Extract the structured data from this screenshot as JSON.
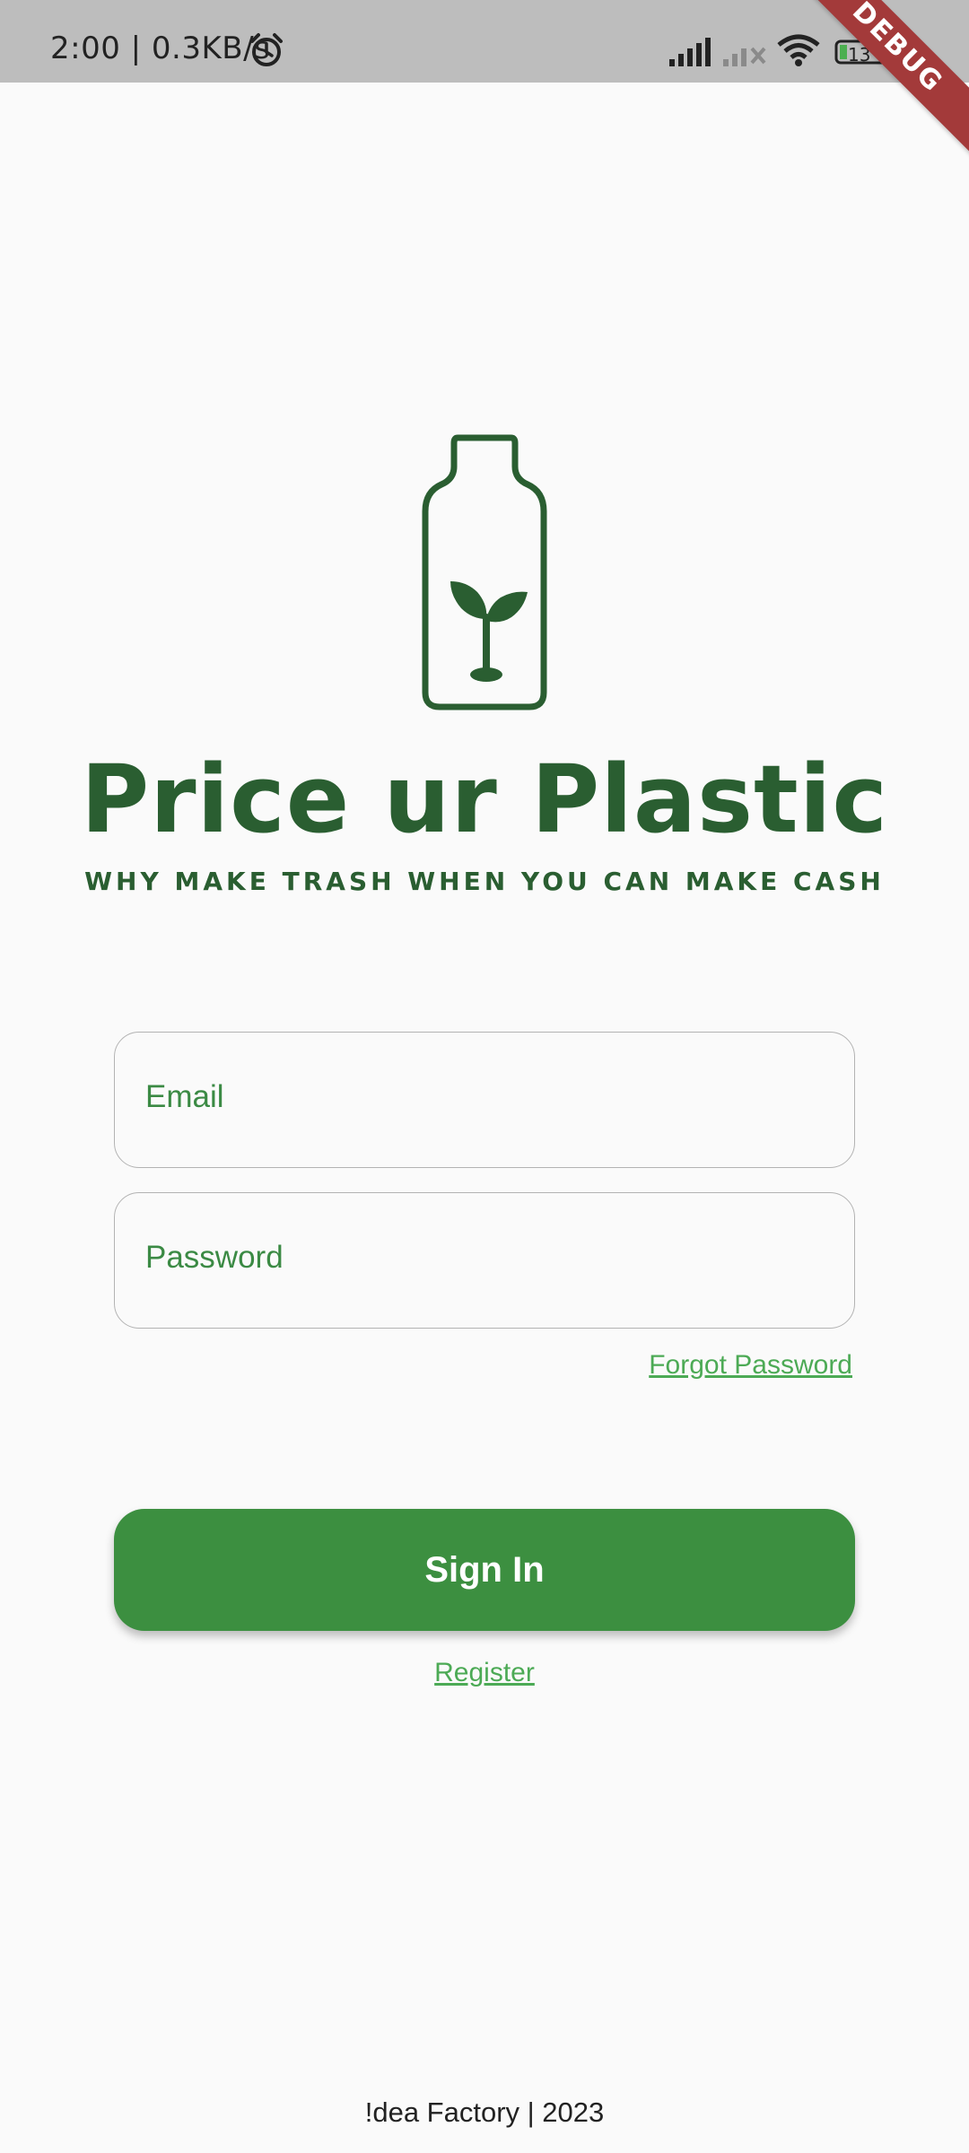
{
  "status_bar": {
    "time": "2:00 | 0.3KB/s",
    "battery": "13"
  },
  "debug_banner": "DEBUG",
  "app": {
    "title": "Price ur Plastic",
    "tagline": "WHY MAKE TRASH WHEN YOU CAN MAKE CASH"
  },
  "form": {
    "email_label": "Email",
    "password_label": "Password",
    "forgot_password": "Forgot Password",
    "sign_in": "Sign In",
    "register": "Register"
  },
  "footer": "!dea Factory | 2023",
  "colors": {
    "brand_dark_green": "#2a5e31",
    "button_green": "#3c8f40",
    "link_green": "#4caa55"
  }
}
